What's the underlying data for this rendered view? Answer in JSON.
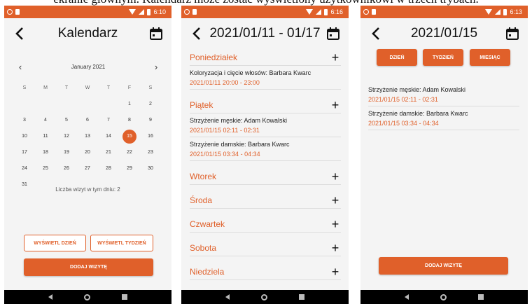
{
  "caption": "ekranie głównym. Kalendarz może zostać wyświetlony użytkownikowi w trzech trybach.",
  "screen1": {
    "time": "6:10",
    "title": "Kalendarz",
    "month": "January 2021",
    "weekdays": [
      "S",
      "M",
      "T",
      "W",
      "T",
      "F",
      "S"
    ],
    "weeks": [
      [
        "",
        "",
        "",
        "",
        "",
        "1",
        "2"
      ],
      [
        "3",
        "4",
        "5",
        "6",
        "7",
        "8",
        "9"
      ],
      [
        "10",
        "11",
        "12",
        "13",
        "14",
        "15",
        "16"
      ],
      [
        "17",
        "18",
        "19",
        "20",
        "21",
        "22",
        "23"
      ],
      [
        "24",
        "25",
        "26",
        "27",
        "28",
        "29",
        "30"
      ],
      [
        "31",
        "",
        "",
        "",
        "",
        "",
        ""
      ]
    ],
    "selected_day": "15",
    "visits_note": "Liczba wizyt w tym dniu: 2",
    "btn_day": "WYŚWIETL DZIEŃ",
    "btn_week": "WYŚWIETL TYDZIEŃ",
    "btn_add": "DODAJ WIZYTĘ"
  },
  "screen2": {
    "time": "6:16",
    "title": "2021/01/11 - 01/17",
    "days": [
      {
        "name": "Poniedziałek",
        "visits": [
          {
            "title": "Koloryzacja i cięcie włosów: Barbara Kwarc",
            "time": "2021/01/11 20:00 - 23:00"
          }
        ]
      },
      {
        "name": "Piątek",
        "visits": [
          {
            "title": "Strzyżenie męskie: Adam Kowalski",
            "time": "2021/01/15 02:11 - 02:31"
          },
          {
            "title": "Strzyżenie damskie: Barbara Kwarc",
            "time": "2021/01/15 03:34 - 04:34"
          }
        ]
      },
      {
        "name": "Wtorek",
        "visits": []
      },
      {
        "name": "Środa",
        "visits": []
      },
      {
        "name": "Czwartek",
        "visits": []
      },
      {
        "name": "Sobota",
        "visits": []
      },
      {
        "name": "Niedziela",
        "visits": []
      }
    ],
    "plus": "+"
  },
  "screen3": {
    "time": "6:13",
    "title": "2021/01/15",
    "tab_day": "DZIEŃ",
    "tab_week": "TYDZIEŃ",
    "tab_month": "MIESIĄC",
    "visits": [
      {
        "title": "Strzyżenie męskie: Adam Kowalski",
        "time": "2021/01/15 02:11 - 02:31"
      },
      {
        "title": "Strzyżenie damskie: Barbara Kwarc",
        "time": "2021/01/15 03:34 - 04:34"
      }
    ],
    "btn_add": "DODAJ WIZYTĘ"
  },
  "colors": {
    "accent": "#e0602a",
    "background": "#f4f4f4",
    "navbar": "#000000"
  },
  "icons": {
    "back": "arrow-back-icon",
    "calendar": "calendar-icon",
    "add": "plus-icon"
  }
}
